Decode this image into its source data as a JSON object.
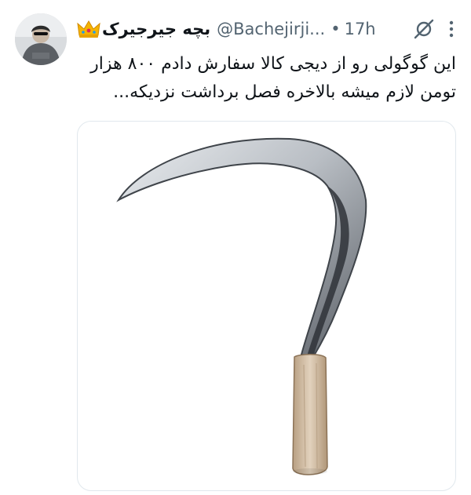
{
  "post": {
    "display_name": "بچه جیرجیرک",
    "handle": "@Bachejirji...",
    "separator": "•",
    "timestamp": "17h",
    "text_line1": "این گوگولی رو از دیجی کالا سفارش دادم ۸۰۰ هزار",
    "text_line2": "تومن لازم میشه بالاخره فصل برداشت نزدیکه..."
  },
  "icons": {
    "crown": "crown-emoji-icon",
    "grok": "grok-icon",
    "more": "more-options-icon"
  },
  "colors": {
    "text": "#0f1419",
    "secondary_text": "#536471",
    "media_border": "#e1e8ed"
  }
}
